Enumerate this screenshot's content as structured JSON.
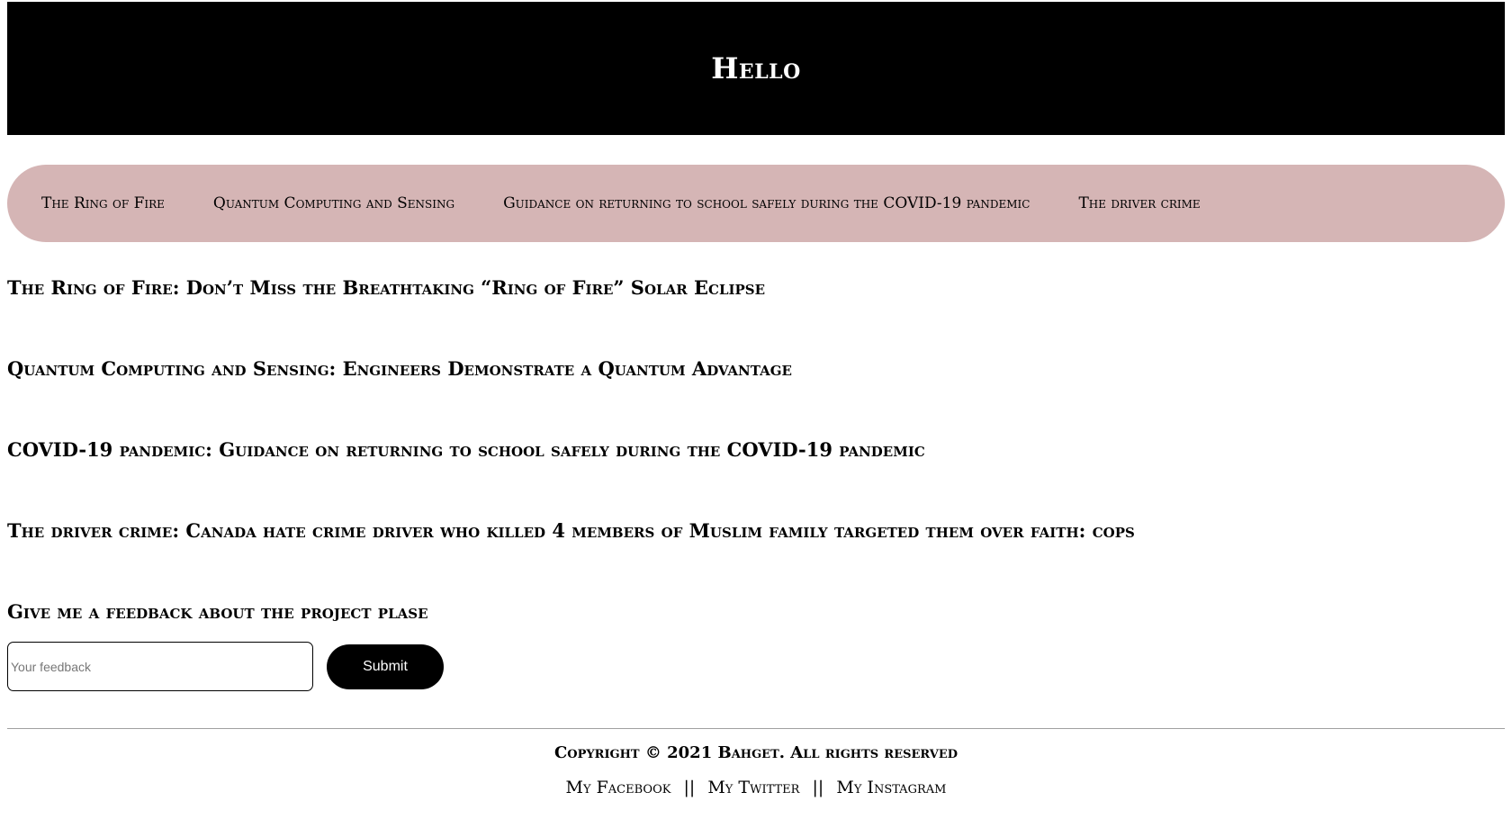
{
  "header": {
    "title": "Hello"
  },
  "nav": {
    "items": [
      "The Ring of Fire",
      "Quantum Computing and Sensing",
      "Guidance on returning to school safely during the COVID-19 pandemic",
      "The driver crime"
    ]
  },
  "articles": [
    {
      "title": "The Ring of Fire: Don’t Miss the Breathtaking “Ring of Fire” Solar Eclipse"
    },
    {
      "title": "Quantum Computing and Sensing: Engineers Demonstrate a Quantum Advantage"
    },
    {
      "title": "COVID-19 pandemic: Guidance on returning to school safely during the COVID-19 pandemic"
    },
    {
      "title": "The driver crime: Canada hate crime driver who killed 4 members of Muslim family targeted them over faith: cops"
    }
  ],
  "feedback": {
    "heading": "Give me a feedback about the project plase",
    "placeholder": "Your feedback",
    "value": "",
    "submit_label": "Submit"
  },
  "footer": {
    "copyright": "Copyright © 2021 Bahget. All rights reserved",
    "links": [
      "My Facebook",
      "My Twitter",
      "My Instagram"
    ],
    "separator": "||"
  },
  "colors": {
    "header_bg": "#000000",
    "nav_bg": "#d5b5b5",
    "button_bg": "#000000"
  }
}
